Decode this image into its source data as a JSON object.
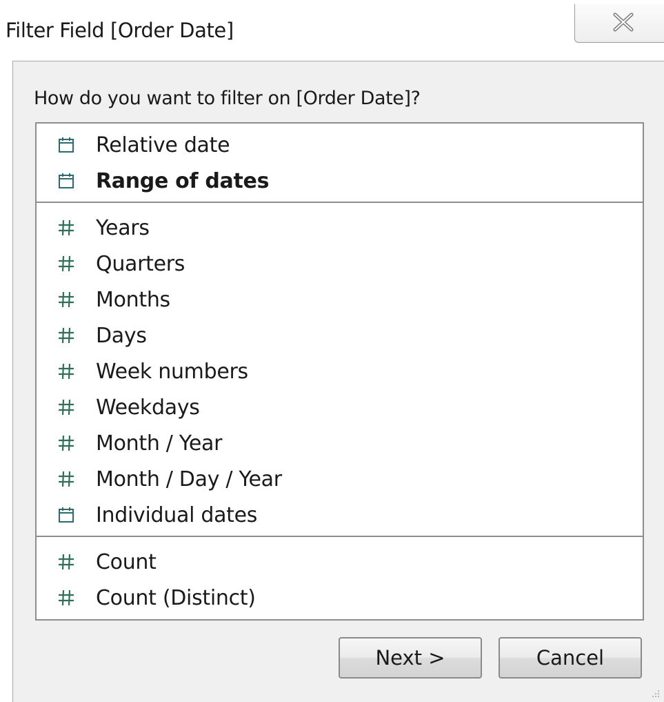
{
  "window": {
    "title": "Filter Field [Order Date]"
  },
  "prompt": "How do you want to filter on [Order Date]?",
  "list": {
    "groups": [
      [
        {
          "label": "Relative date",
          "icon": "calendar-icon",
          "bold": false
        },
        {
          "label": "Range of dates",
          "icon": "calendar-icon",
          "bold": true
        }
      ],
      [
        {
          "label": "Years",
          "icon": "hash-icon"
        },
        {
          "label": "Quarters",
          "icon": "hash-icon"
        },
        {
          "label": "Months",
          "icon": "hash-icon"
        },
        {
          "label": "Days",
          "icon": "hash-icon"
        },
        {
          "label": "Week numbers",
          "icon": "hash-icon"
        },
        {
          "label": "Weekdays",
          "icon": "hash-icon"
        },
        {
          "label": "Month / Year",
          "icon": "hash-icon"
        },
        {
          "label": "Month / Day / Year",
          "icon": "hash-icon"
        },
        {
          "label": "Individual dates",
          "icon": "calendar-icon"
        }
      ],
      [
        {
          "label": "Count",
          "icon": "hash-icon"
        },
        {
          "label": "Count (Distinct)",
          "icon": "hash-icon"
        }
      ]
    ]
  },
  "buttons": {
    "next_label": "Next >",
    "cancel_label": "Cancel"
  },
  "colors": {
    "calendar_icon": "#2b6a6e",
    "hash_icon": "#2f6e5a",
    "dialog_bg": "#f0f0f0"
  }
}
